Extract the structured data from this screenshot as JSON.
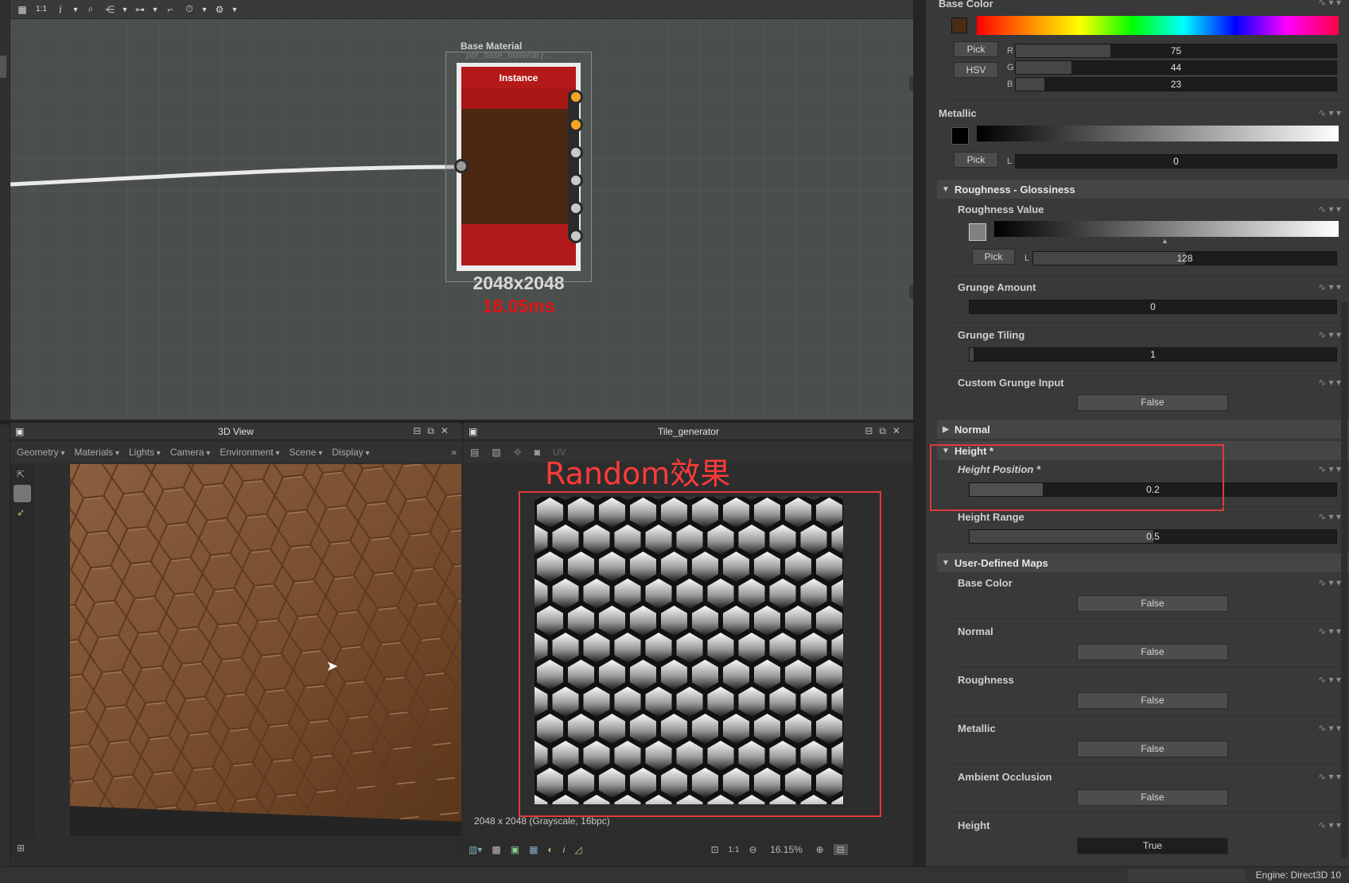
{
  "graph": {
    "toolbar_icons": [
      "grid-icon",
      "ratio-icon",
      "info-icon",
      "zoom-icon",
      "share-icon",
      "link-icon",
      "frame-icon",
      "timer-icon",
      "gear-icon"
    ],
    "ratio_label": "1:1",
    "node": {
      "title": "Base Material",
      "subtitle": "pbr_base_material (...",
      "header": "Instance",
      "size": "2048x2048",
      "time": "18.05ms"
    }
  },
  "view3d": {
    "title": "3D View",
    "menus": [
      "Geometry",
      "Materials",
      "Lights",
      "Camera",
      "Environment",
      "Scene",
      "Display"
    ]
  },
  "view2d": {
    "title": "Tile_generator",
    "uv_label": "UV",
    "annotation": "Random效果",
    "status": "2048 x 2048 (Grayscale, 16bpc)",
    "ratio_label": "1:1",
    "zoom": "16.15%"
  },
  "props": {
    "base_color": {
      "label": "Base Color",
      "swatch": "#4b2c17",
      "pick": "Pick",
      "hsv": "HSV",
      "r": 75,
      "g": 44,
      "b": 23,
      "r_label": "R",
      "g_label": "G",
      "b_label": "B"
    },
    "metallic": {
      "label": "Metallic",
      "pick": "Pick",
      "l_label": "L",
      "value": 0
    },
    "roughness_section": "Roughness - Glossiness",
    "roughness_value": {
      "label": "Roughness Value",
      "pick": "Pick",
      "l_label": "L",
      "value": 128
    },
    "grunge_amount": {
      "label": "Grunge Amount",
      "value": 0
    },
    "grunge_tiling": {
      "label": "Grunge Tiling",
      "value": 1
    },
    "custom_grunge": {
      "label": "Custom Grunge Input",
      "value": "False"
    },
    "normal_section": "Normal",
    "height_section": "Height *",
    "height_position": {
      "label": "Height Position *",
      "value": 0.2
    },
    "height_range": {
      "label": "Height Range",
      "value": 0.5
    },
    "user_maps_section": "User-Defined Maps",
    "user_maps": [
      {
        "label": "Base Color",
        "value": "False"
      },
      {
        "label": "Normal",
        "value": "False"
      },
      {
        "label": "Roughness",
        "value": "False"
      },
      {
        "label": "Metallic",
        "value": "False"
      },
      {
        "label": "Ambient Occlusion",
        "value": "False"
      },
      {
        "label": "Height",
        "value": "True"
      }
    ]
  },
  "status_bar": {
    "engine": "Engine: Direct3D 10"
  },
  "colors": {
    "accent_red": "#e03a3a",
    "node_red": "#b41a1a",
    "port_orange": "#f5a623"
  }
}
